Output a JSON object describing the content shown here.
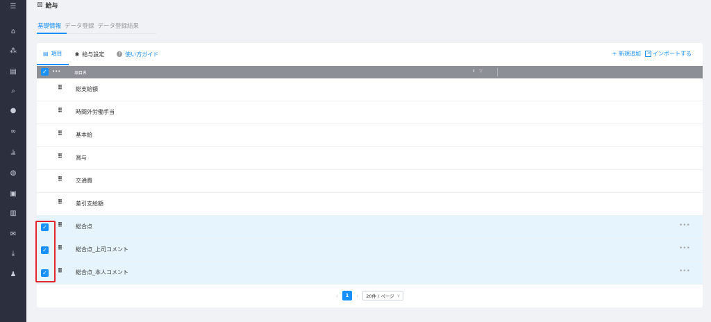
{
  "sidebar": {
    "icons": [
      {
        "name": "menu-icon",
        "glyph": "☰"
      },
      {
        "name": "home-icon",
        "glyph": "⌂"
      },
      {
        "name": "org-chart-icon",
        "glyph": "⁂"
      },
      {
        "name": "document-icon",
        "glyph": "▤"
      },
      {
        "name": "search-icon",
        "glyph": "⌕"
      },
      {
        "name": "chat-icon",
        "glyph": "●"
      },
      {
        "name": "link-icon",
        "glyph": "∞"
      },
      {
        "name": "analytics-icon",
        "glyph": "⫡"
      },
      {
        "name": "globe-icon",
        "glyph": "◍"
      },
      {
        "name": "contacts-icon",
        "glyph": "▣"
      },
      {
        "name": "book-icon",
        "glyph": "▥"
      },
      {
        "name": "mail-icon",
        "glyph": "✉"
      },
      {
        "name": "download-icon",
        "glyph": "⤓"
      },
      {
        "name": "user-settings-icon",
        "glyph": "♟"
      }
    ]
  },
  "page": {
    "title": "給与",
    "title_icon": "▧"
  },
  "main_tabs": [
    {
      "label": "基礎情報",
      "active": true
    },
    {
      "label": "データ登録",
      "active": false
    },
    {
      "label": "データ登録結果",
      "active": false
    }
  ],
  "sub_tabs": [
    {
      "label": "項目",
      "icon": "▤",
      "active": true
    },
    {
      "label": "給与設定",
      "icon": "✱",
      "active": false
    },
    {
      "label": "使い方ガイド",
      "icon": "?",
      "active": false
    }
  ],
  "actions": {
    "add_label": "+ 新規追加",
    "import_label": "インポートする",
    "import_icon": "⇥"
  },
  "table": {
    "header_label": "項目名",
    "header_dots": "•••",
    "sort_icons": "⇕ ▽",
    "rows": [
      {
        "name": "総支給額",
        "selected": false
      },
      {
        "name": "時間外労働手当",
        "selected": false
      },
      {
        "name": "基本給",
        "selected": false
      },
      {
        "name": "賞与",
        "selected": false
      },
      {
        "name": "交通費",
        "selected": false
      },
      {
        "name": "差引支給額",
        "selected": false
      },
      {
        "name": "総合点",
        "selected": true
      },
      {
        "name": "総合点_上司コメント",
        "selected": true
      },
      {
        "name": "総合点_本人コメント",
        "selected": true
      }
    ]
  },
  "pagination": {
    "prev": "‹",
    "next": "›",
    "current_page": "1",
    "page_size": "20件 / ページ"
  },
  "colors": {
    "accent": "#1890ff",
    "sidebar_bg": "#2b2f3e",
    "header_bg": "#8c8f96",
    "selected_row": "#e6f4fd",
    "highlight": "#e5242c"
  }
}
